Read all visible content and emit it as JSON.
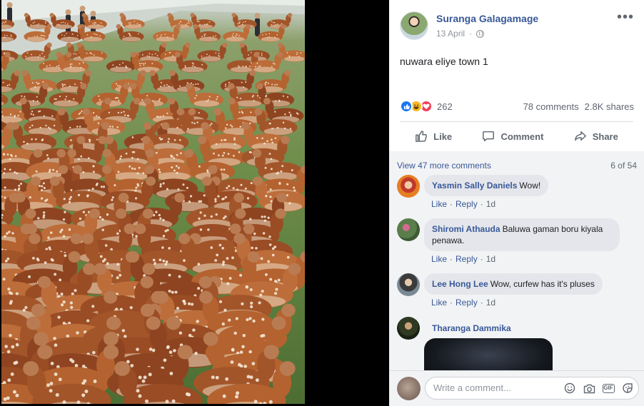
{
  "post": {
    "author": "Suranga Galagamage",
    "date": "13 April",
    "privacy_icon": "globe-icon",
    "caption": "nuwara eliye town 1",
    "reactions": {
      "icons": [
        "like-reaction-icon",
        "haha-reaction-icon",
        "love-reaction-icon"
      ],
      "count": "262"
    },
    "comments_count": "78 comments",
    "shares_count": "2.8K shares"
  },
  "actions": {
    "like": "Like",
    "comment": "Comment",
    "share": "Share"
  },
  "comments_panel": {
    "view_more": "View 47 more comments",
    "page_info": "6 of 54",
    "items": [
      {
        "name": "Yasmin Sally Daniels",
        "text": "Wow!",
        "like": "Like",
        "reply": "Reply",
        "time": "1d"
      },
      {
        "name": "Shiromi Athauda",
        "text": "Baluwa gaman boru kiyala penawa.",
        "like": "Like",
        "reply": "Reply",
        "time": "1d"
      },
      {
        "name": "Lee Hong Lee",
        "text": "Wow, curfew has it's pluses",
        "like": "Like",
        "reply": "Reply",
        "time": "1d"
      },
      {
        "name": "Tharanga Dammika",
        "text": ""
      }
    ]
  },
  "composer": {
    "placeholder": "Write a comment...",
    "icons": [
      "emoji-icon",
      "camera-icon",
      "gif-icon",
      "sticker-icon"
    ]
  },
  "colors": {
    "link": "#385898",
    "muted": "#606770",
    "bubble": "#e4e6eb",
    "panel": "#f2f3f5"
  }
}
